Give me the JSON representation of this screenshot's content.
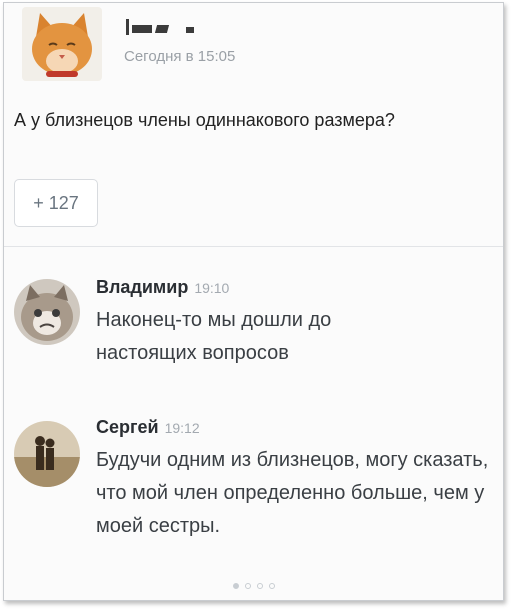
{
  "post": {
    "author_redacted": "",
    "time": "Сегодня в 15:05",
    "text": "А у близнецов члены одиннакового размера?",
    "like_count": "+ 127"
  },
  "comments": [
    {
      "name": "Владимир",
      "time": "19:10",
      "text": "Наконец-то мы дошли до настоящих вопросов",
      "avatar_icon": "grumpy-cat-avatar"
    },
    {
      "name": "Сергей",
      "time": "19:12",
      "text": "Будучи одним из близнецов, могу сказать, что мой член определенно больше, чем у моей сестры.",
      "avatar_icon": "couple-silhouette-avatar"
    }
  ],
  "pagination": {
    "dots": 4,
    "active_index": 0
  },
  "colors": {
    "text_primary": "#222222",
    "text_secondary": "#9aa0a6",
    "divider": "#e2e4e7"
  }
}
